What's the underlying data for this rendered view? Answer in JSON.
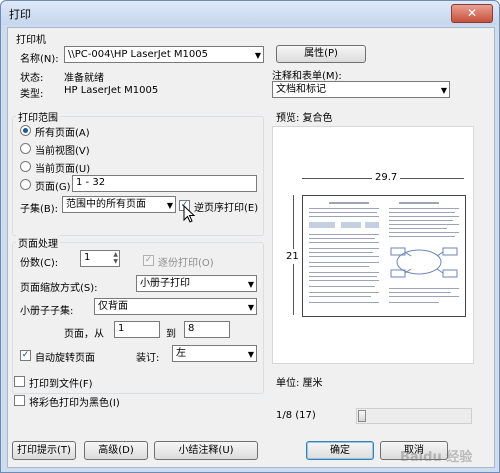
{
  "window": {
    "title": "打印",
    "close_glyph": "✕"
  },
  "printer": {
    "group_title": "打印机",
    "name_label": "名称(N):",
    "name_value": "\\\\PC-004\\HP LaserJet M1005",
    "properties_button": "属性(P)",
    "status_label": "状态:",
    "status_value": "准备就绪",
    "type_label": "类型:",
    "type_value": "HP LaserJet M1005",
    "comments_label": "注释和表单(M):",
    "comments_value": "文档和标记"
  },
  "range": {
    "group_title": "打印范围",
    "options": [
      "所有页面(A)",
      "当前视图(V)",
      "当前页面(U)",
      "页面(G)"
    ],
    "selected_index": 0,
    "pages_value": "1 - 32",
    "subset_label": "子集(B):",
    "subset_value": "范围中的所有页面",
    "reverse_label": "逆页序打印(E)",
    "reverse_checked": true
  },
  "handling": {
    "group_title": "页面处理",
    "copies_label": "份数(C):",
    "copies_value": "1",
    "collate_label": "逐份打印(O)",
    "scaling_label": "页面缩放方式(S):",
    "scaling_value": "小册子打印",
    "booklet_label": "小册子子集:",
    "booklet_value": "仅背面",
    "pages_from_label": "页面，从",
    "pages_from_value": "1",
    "pages_to_label": "到",
    "pages_to_value": "8",
    "autorotate_label": "自动旋转页面",
    "autorotate_checked": true,
    "binding_label": "装订:",
    "binding_value": "左"
  },
  "options": {
    "print_to_file": "打印到文件(F)",
    "print_color_as_black": "将彩色打印为黑色(I)"
  },
  "preview": {
    "label": "预览: 复合色",
    "width_dim": "29.7",
    "height_dim": "21",
    "units": "单位: 厘米",
    "page_counter": "1/8 (17)"
  },
  "footer": {
    "tips_button": "打印提示(T)",
    "advanced_button": "高级(D)",
    "summarize_button": "小结注释(U)",
    "ok_button": "确定",
    "cancel_button": "取消"
  },
  "watermark": "Baidu 经验"
}
